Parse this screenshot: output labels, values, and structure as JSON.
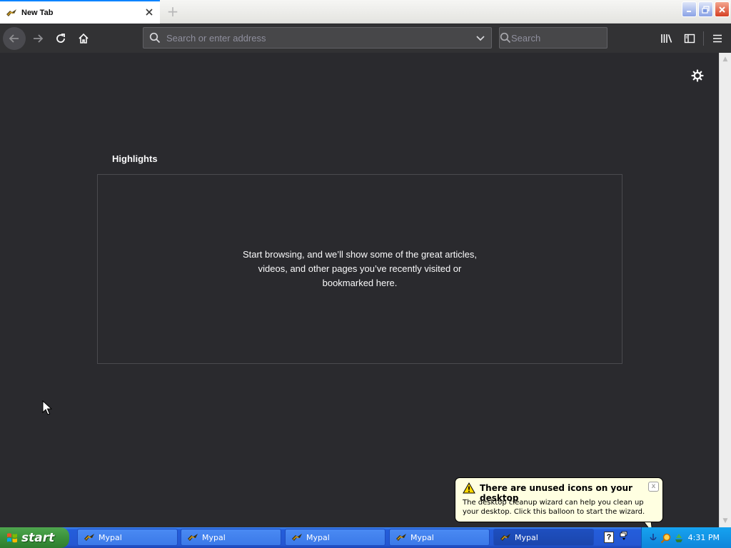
{
  "tabs": [
    {
      "title": "New Tab",
      "active": true
    }
  ],
  "newtab_glyph": "+",
  "urlbar": {
    "placeholder": "Search or enter address"
  },
  "searchbar": {
    "placeholder": "Search"
  },
  "highlights": {
    "title": "Highlights",
    "empty_message": "Start browsing, and we’ll show some of the great articles, videos, and other pages you’ve recently visited or bookmarked here."
  },
  "balloon": {
    "title": "There are unused icons on your desktop",
    "body": "The desktop cleanup wizard can help you clean up your desktop. Click this balloon to start the wizard.",
    "close_glyph": "x"
  },
  "taskbar": {
    "start_label": "start",
    "tasks": [
      {
        "label": "Mypal",
        "active": false
      },
      {
        "label": "Mypal",
        "active": false
      },
      {
        "label": "Mypal",
        "active": false
      },
      {
        "label": "Mypal",
        "active": false
      },
      {
        "label": "Mypal",
        "active": true
      }
    ],
    "tray_help_glyph": "?",
    "clock": "4:31 PM"
  },
  "colors": {
    "content_bg": "#2a2a2e",
    "toolbar_bg": "#323234",
    "field_bg": "#474749",
    "accent": "#0a84ff",
    "taskbar_blue": "#245edb",
    "start_green": "#3b923b",
    "balloon_bg": "#ffffe1"
  },
  "icons": [
    "mypal-icon",
    "close-icon",
    "back-icon",
    "forward-icon",
    "reload-icon",
    "home-icon",
    "search-icon",
    "chevron-down-icon",
    "library-icon",
    "sidebar-icon",
    "hamburger-menu-icon",
    "gear-icon",
    "warning-icon",
    "windows-logo-icon"
  ]
}
